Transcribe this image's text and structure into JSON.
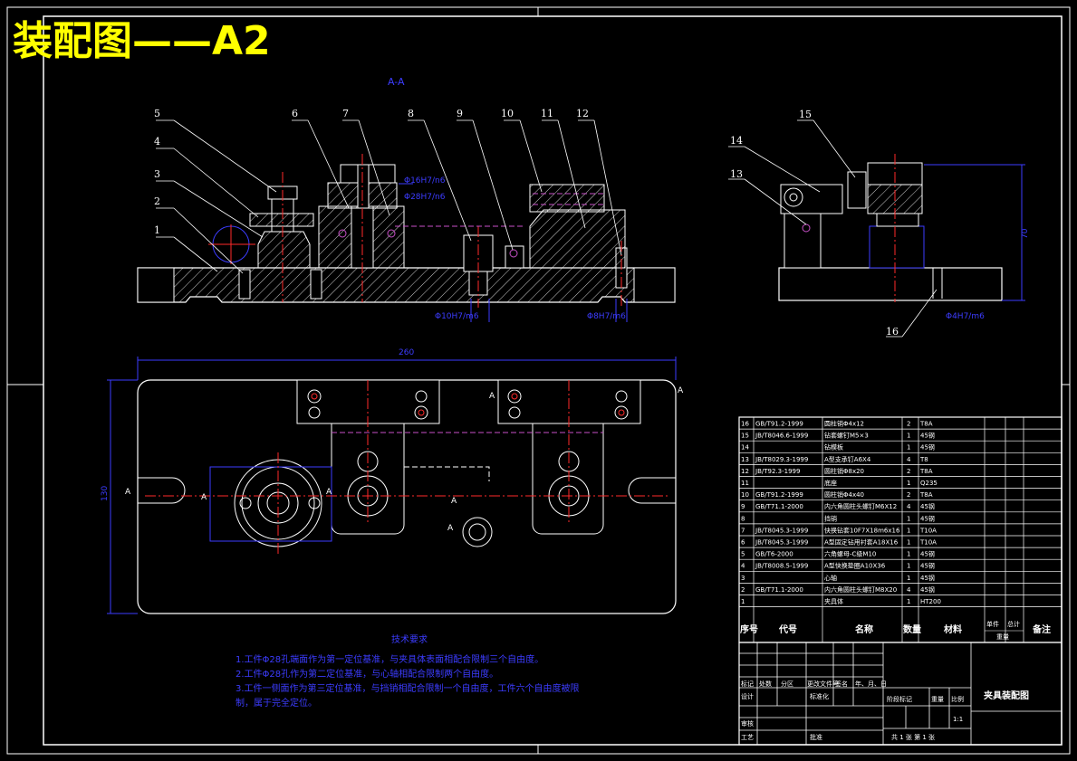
{
  "title": "装配图——A2",
  "section_label": "A-A",
  "part_labels": [
    "1",
    "2",
    "3",
    "4",
    "5",
    "6",
    "7",
    "8",
    "9",
    "10",
    "11",
    "12",
    "13",
    "14",
    "15",
    "16"
  ],
  "dimensions": {
    "width_260": "260",
    "height_130": "130",
    "height_70": "70",
    "d10": "Φ10H7/m6",
    "d8": "Φ8H7/m6",
    "d4": "Φ4H7/m6",
    "d16": "Φ16H7/n6",
    "d28": "Φ28H7/n6"
  },
  "view_markers": [
    "A",
    "A",
    "A",
    "A",
    "A",
    "A",
    "A"
  ],
  "tech_requirements": {
    "heading": "技术要求",
    "lines": [
      "1.工件Φ28孔端面作为第一定位基准，与夹具体表面相配合限制三个自由度。",
      "2.工件Φ28孔作为第二定位基准，与心轴相配合限制两个自由度。",
      "3.工件一侧面作为第三定位基准，与挡销相配合限制一个自由度，工件六个自由度被限",
      "制，属于完全定位。"
    ]
  },
  "bom": {
    "rows": [
      {
        "no": "16",
        "code": "GB/T91.2-1999",
        "name": "圆柱销Φ4x12",
        "qty": "2",
        "mat": "T8A"
      },
      {
        "no": "15",
        "code": "JB/T8046.6-1999",
        "name": "钻套螺钉M5×3",
        "qty": "1",
        "mat": "45钢"
      },
      {
        "no": "14",
        "code": "",
        "name": "钻模板",
        "qty": "1",
        "mat": "45钢"
      },
      {
        "no": "13",
        "code": "JB/T8029.3-1999",
        "name": "A型支承钉A6X4",
        "qty": "4",
        "mat": "T8"
      },
      {
        "no": "12",
        "code": "JB/T92.3-1999",
        "name": "圆柱销Φ8x20",
        "qty": "2",
        "mat": "T8A"
      },
      {
        "no": "11",
        "code": "",
        "name": "底座",
        "qty": "1",
        "mat": "Q235"
      },
      {
        "no": "10",
        "code": "GB/T91.2-1999",
        "name": "圆柱销Φ4x40",
        "qty": "2",
        "mat": "T8A"
      },
      {
        "no": "9",
        "code": "GB/T71.1-2000",
        "name": "内六角圆柱头螺钉M6X12",
        "qty": "4",
        "mat": "45钢"
      },
      {
        "no": "8",
        "code": "",
        "name": "挡销",
        "qty": "1",
        "mat": "45钢"
      },
      {
        "no": "7",
        "code": "JB/T8045.3-1999",
        "name": "快换钻套10F7X18m6x16",
        "qty": "1",
        "mat": "T10A"
      },
      {
        "no": "6",
        "code": "JB/T8045.3-1999",
        "name": "A型固定钻用衬套A18X16",
        "qty": "1",
        "mat": "T10A"
      },
      {
        "no": "5",
        "code": "GB/T6-2000",
        "name": "六角螺母-C级M10",
        "qty": "1",
        "mat": "45钢"
      },
      {
        "no": "4",
        "code": "JB/T8008.5-1999",
        "name": "A型快换垫圈A10X36",
        "qty": "1",
        "mat": "45钢"
      },
      {
        "no": "3",
        "code": "",
        "name": "心轴",
        "qty": "1",
        "mat": "45钢"
      },
      {
        "no": "2",
        "code": "GB/T71.1-2000",
        "name": "内六角圆柱头螺钉M8X20",
        "qty": "4",
        "mat": "45钢"
      },
      {
        "no": "1",
        "code": "",
        "name": "夹具体",
        "qty": "1",
        "mat": "HT200"
      }
    ],
    "header": {
      "no": "序号",
      "code": "代号",
      "name": "名称",
      "qty": "数量",
      "mat": "材料",
      "unit": "单件",
      "total": "总计",
      "weight": "重量",
      "note": "备注"
    }
  },
  "title_block": {
    "drawing_name": "夹具装配图",
    "labels": [
      "标记",
      "处数",
      "分区",
      "更改文件号",
      "签名",
      "年、月、日",
      "设计",
      "标准化",
      "审核",
      "工艺",
      "批准",
      "阶段标记",
      "重量",
      "比例"
    ],
    "scale": "1:1",
    "sheet": "共 1 张  第 1 张"
  },
  "colors": {
    "line": "#ffffff",
    "accent": "#ffff00",
    "dim": "#3c3cff",
    "center": "#ff2a2a",
    "hidden": "#c850c8",
    "hatch": "#ffffff"
  }
}
